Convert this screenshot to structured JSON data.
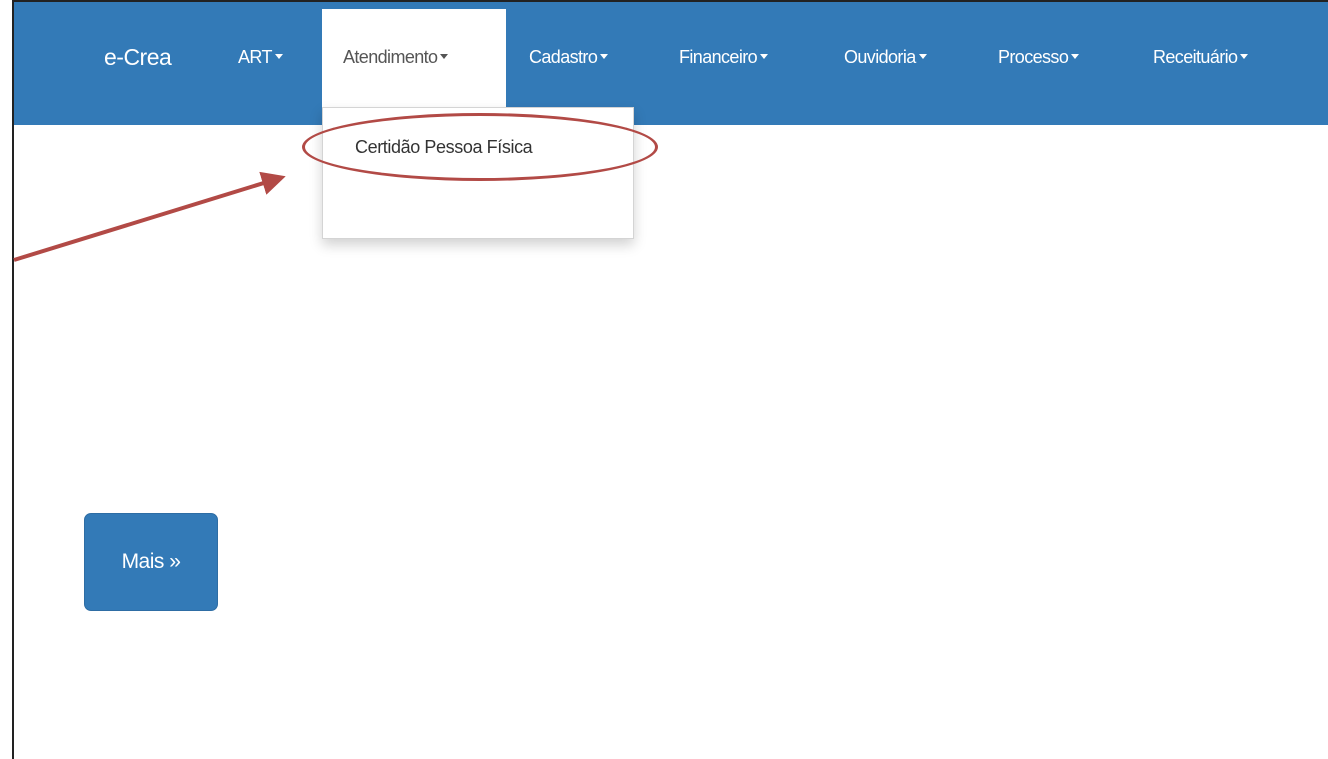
{
  "navbar": {
    "brand": "e-Crea",
    "items": [
      {
        "label": "ART"
      },
      {
        "label": "Atendimento"
      },
      {
        "label": "Cadastro"
      },
      {
        "label": "Financeiro"
      },
      {
        "label": "Ouvidoria"
      },
      {
        "label": "Processo"
      },
      {
        "label": "Receituário"
      }
    ],
    "active_item": "Atendimento",
    "color": "#337ab7"
  },
  "dropdown": {
    "items": [
      {
        "label": "Certidão Pessoa Física"
      }
    ]
  },
  "annotation": {
    "color": "#b24a46"
  },
  "main": {
    "more_button_label": "Mais »"
  }
}
